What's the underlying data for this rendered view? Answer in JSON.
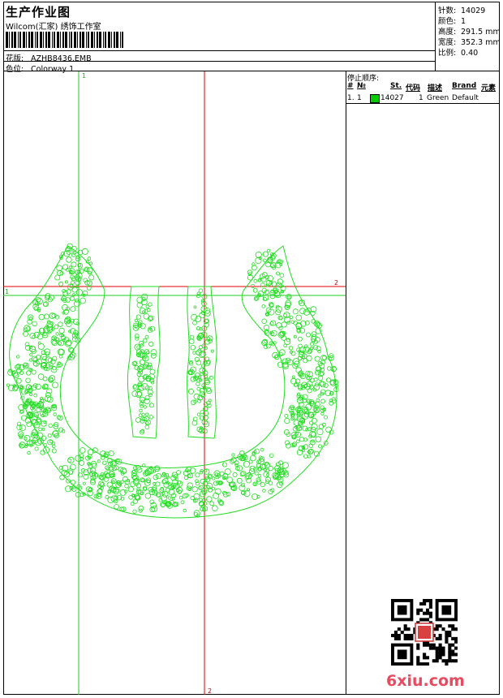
{
  "header": {
    "title": "生产作业图",
    "subtitle": "Wilcom(汇家) 绣饰工作室",
    "design_label": "花版:",
    "design_value": "AZHB8436.EMB",
    "colorway_label": "色位:",
    "colorway_value": "Colorway 1"
  },
  "stats": [
    {
      "label": "针数:",
      "value": "14029"
    },
    {
      "label": "颜色:",
      "value": "1"
    },
    {
      "label": "高度:",
      "value": "291.5 mm"
    },
    {
      "label": "宽度:",
      "value": "352.3 mm"
    },
    {
      "label": "比例:",
      "value": "0.40"
    }
  ],
  "sequence": {
    "title": "停止顺序:",
    "columns": {
      "hash": "#",
      "no": "№",
      "st": "St.",
      "code": "代码",
      "desc": "描述",
      "brand": "Brand",
      "element": "元素"
    },
    "rows": [
      {
        "index": "1.",
        "no": "1",
        "color": "#00cc00",
        "stitches": "14027",
        "code": "1",
        "desc": "Green",
        "brand": "Default"
      }
    ]
  },
  "guides": {
    "green_v_label": "1",
    "green_h_label": "1",
    "red_h_label": "2",
    "red_v_label": "2"
  },
  "watermark": "6xiu.com",
  "colors": {
    "stitch": "#22dd22",
    "guide_green": "#22cc22",
    "guide_red": "#dd0000"
  }
}
